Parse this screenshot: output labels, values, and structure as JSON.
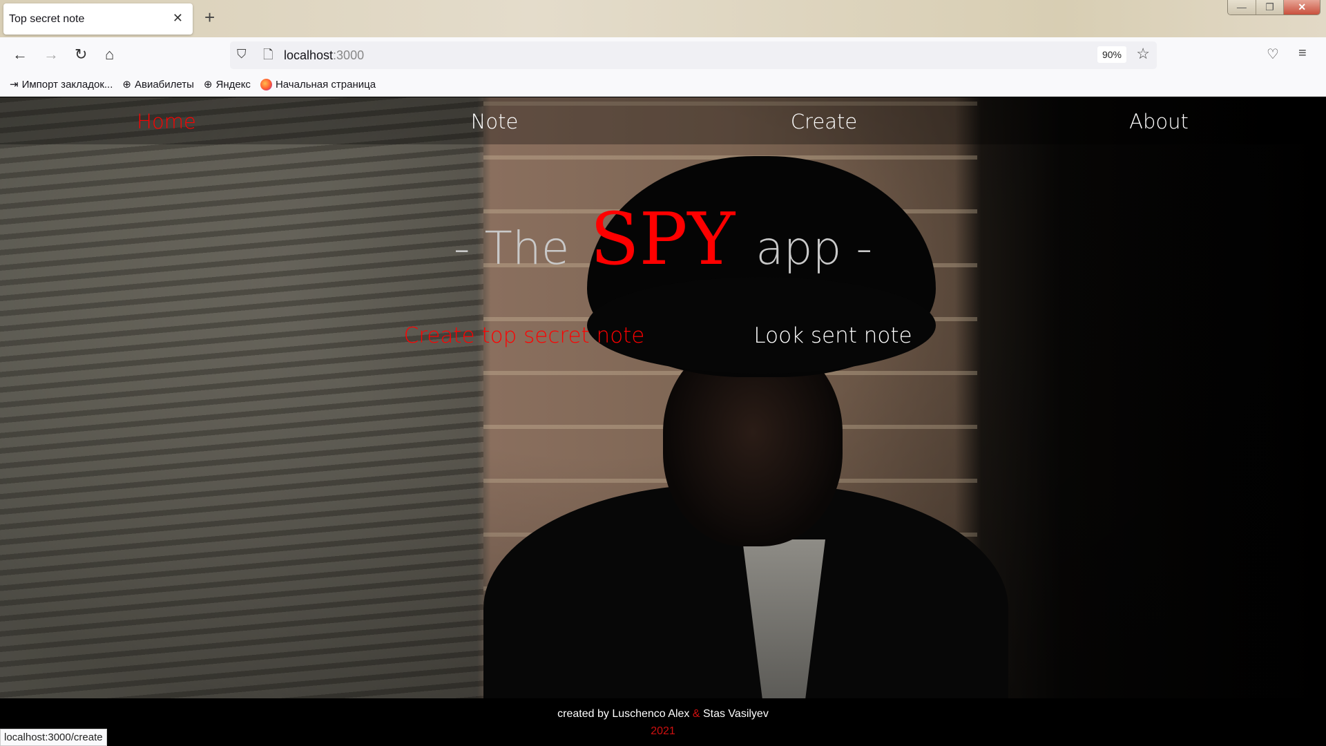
{
  "browser": {
    "tab_title": "Top secret note",
    "url_host": "localhost",
    "url_port": ":3000",
    "zoom": "90%",
    "bookmarks": [
      "Импорт закладок...",
      "Авиабилеты",
      "Яндекс",
      "Начальная страница"
    ],
    "status_url": "localhost:3000/create"
  },
  "nav": {
    "items": [
      "Home",
      "Note",
      "Create",
      "About"
    ],
    "active": "Home"
  },
  "hero": {
    "prefix": "- The",
    "brand": "SPY",
    "suffix": "app -",
    "create_link": "Create top secret note",
    "look_link": "Look sent note"
  },
  "footer": {
    "created_by": "created by Luschenco Alex",
    "amp": "&",
    "coauthor": "Stas Vasilyev",
    "year": "2021"
  },
  "colors": {
    "accent": "#ff0000",
    "footer_red": "#d01010"
  }
}
